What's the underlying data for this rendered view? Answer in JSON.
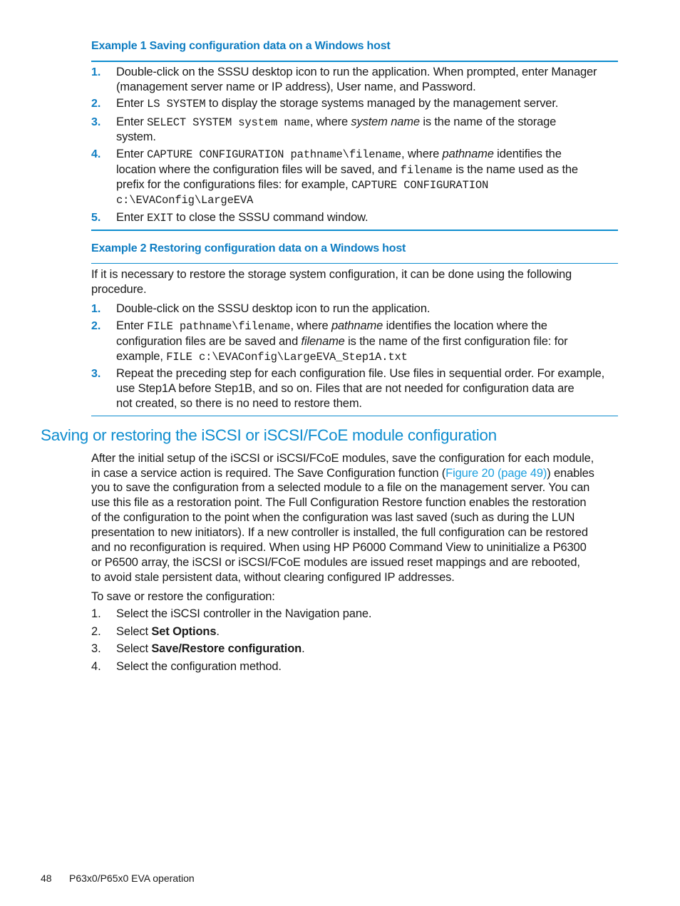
{
  "example1": {
    "title": "Example 1 Saving configuration data on a Windows host",
    "steps": [
      {
        "num": "1.",
        "lines": [
          "Double-click on the SSSU desktop icon to run the application. When prompted, enter Manager",
          "(management server name or IP address), User name, and Password."
        ]
      },
      {
        "num": "2.",
        "pre": "Enter ",
        "code": "LS SYSTEM",
        "post": " to display the storage systems managed by the management server."
      },
      {
        "num": "3.",
        "pre": "Enter ",
        "code": "SELECT SYSTEM system name",
        "mid": ", where ",
        "em": "system name",
        "post": " is the name of the storage",
        "line2": "system."
      },
      {
        "num": "4.",
        "pre": "Enter ",
        "code": "CAPTURE CONFIGURATION pathname\\filename",
        "mid": ", where ",
        "em": "pathname",
        "post": " identifies the",
        "line2_pre": "location where the configuration files will be saved, and ",
        "line2_code": "filename",
        "line2_post": " is the name used as the",
        "line3_pre": "prefix for the configurations files: for example, ",
        "line3_code": "CAPTURE CONFIGURATION",
        "line4_code": "c:\\EVAConfig\\LargeEVA"
      },
      {
        "num": "5.",
        "pre": "Enter ",
        "code": "EXIT",
        "post": " to close the SSSU command window."
      }
    ]
  },
  "example2": {
    "title": "Example 2 Restoring configuration data on a Windows host",
    "intro": [
      "If it is necessary to restore the storage system configuration, it can be done using the following",
      "procedure."
    ],
    "steps": [
      {
        "num": "1.",
        "text": "Double-click on the SSSU desktop icon to run the application."
      },
      {
        "num": "2.",
        "pre": "Enter ",
        "code": "FILE pathname\\filename",
        "mid": ", where ",
        "em": "pathname",
        "post": " identifies the location where the",
        "line2_pre": "configuration files are be saved and ",
        "line2_em": "filename",
        "line2_post": " is the name of the first configuration file: for",
        "line3_pre": "example, ",
        "line3_code": "FILE c:\\EVAConfig\\LargeEVA_Step1A.txt"
      },
      {
        "num": "3.",
        "lines": [
          "Repeat the preceding step for each configuration file. Use files in sequential order. For example,",
          "use Step1A before Step1B, and so on. Files that are not needed for configuration data are",
          "not created, so there is no need to restore them."
        ]
      }
    ]
  },
  "section": {
    "heading": "Saving or restoring the iSCSI or iSCSI/FCoE module configuration",
    "para": {
      "l1": "After the initial setup of the iSCSI or iSCSI/FCoE modules, save the configuration for each module,",
      "l2_pre": "in case a service action is required. The Save Configuration function (",
      "l2_link": "Figure 20 (page 49)",
      "l2_post": ") enables",
      "l3": "you to save the configuration from a selected module to a file on the management server. You can",
      "l4": "use this file as a restoration point. The Full Configuration Restore function enables the restoration",
      "l5": "of the configuration to the point when the configuration was last saved (such as during the LUN",
      "l6": "presentation to new initiators). If a new controller is installed, the full configuration can be restored",
      "l7": "and no reconfiguration is required. When using HP P6000 Command View to uninitialize a P6300",
      "l8": "or P6500 array, the iSCSI or iSCSI/FCoE modules are issued reset mappings and are rebooted,",
      "l9": "to avoid stale persistent data, without clearing configured IP addresses."
    },
    "lead": "To save or restore the configuration:",
    "steps": [
      {
        "num": "1.",
        "pre": "Select the iSCSI controller in the Navigation pane.",
        "bold": "",
        "post": ""
      },
      {
        "num": "2.",
        "pre": "Select ",
        "bold": "Set Options",
        "post": "."
      },
      {
        "num": "3.",
        "pre": "Select ",
        "bold": "Save/Restore configuration",
        "post": "."
      },
      {
        "num": "4.",
        "pre": "Select the configuration method.",
        "bold": "",
        "post": ""
      }
    ]
  },
  "footer": {
    "page_number": "48",
    "title": "P63x0/P65x0 EVA operation"
  },
  "colors": {
    "accent": "#0e8dcf",
    "heading": "#0e7dc2",
    "link": "#1ea0df"
  }
}
